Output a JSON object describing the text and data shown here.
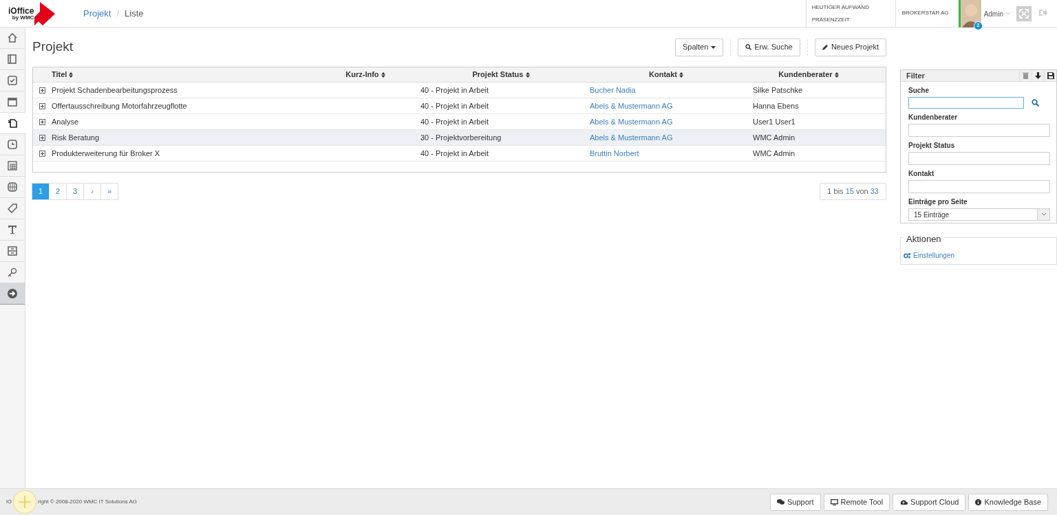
{
  "header": {
    "logo_text": "iOffice",
    "logo_sub": "by WMC",
    "breadcrumb": [
      "Projekt",
      "/",
      "Liste"
    ],
    "info": [
      "HEUTIGER AUFWAND",
      "PRÄSENZZEIT"
    ],
    "company": "BROKERSTAR AG",
    "user": "Admin",
    "notification_count": "2"
  },
  "sidebar": {
    "items": [
      {
        "kind": "home",
        "selected": false
      },
      {
        "kind": "notebook",
        "selected": false
      },
      {
        "kind": "check",
        "selected": false
      },
      {
        "kind": "calendar",
        "selected": false
      },
      {
        "kind": "project",
        "selected": true
      },
      {
        "kind": "clock",
        "selected": false
      },
      {
        "kind": "table",
        "selected": false
      },
      {
        "kind": "globe",
        "selected": false
      },
      {
        "kind": "tag",
        "selected": false
      },
      {
        "kind": "text",
        "selected": false
      },
      {
        "kind": "form",
        "selected": false
      },
      {
        "kind": "key",
        "selected": false
      },
      {
        "kind": "arrow",
        "selected": false
      }
    ]
  },
  "page": {
    "title": "Projekt",
    "buttons": [
      {
        "kind": "dropdown",
        "label": "Spalten"
      },
      {
        "kind": "search",
        "label": "Erw. Suche"
      },
      {
        "kind": "edit",
        "label": "Neues Projekt"
      }
    ]
  },
  "table": {
    "columns": [
      "Titel",
      "Kurz-Info",
      "Projekt Status",
      "Kontakt",
      "Kundenberater"
    ],
    "rows": [
      {
        "title": "Projekt Schadenbearbeitungsprozess",
        "status": "40 - Projekt in Arbeit",
        "contact": "Bucher Nadia",
        "advisor": "Silke Patschke",
        "selected": false
      },
      {
        "title": "Offertausschreibung Motorfahrzeugflotte",
        "status": "40 - Projekt in Arbeit",
        "contact": "Abels & Mustermann AG",
        "advisor": "Hanna Ebens",
        "selected": false
      },
      {
        "title": "Analyse",
        "status": "40 - Projekt in Arbeit",
        "contact": "Abels & Mustermann AG",
        "advisor": "User1 User1",
        "selected": false
      },
      {
        "title": "Risk Beratung",
        "status": "30 - Projektvorbereitung",
        "contact": "Abels & Mustermann AG",
        "advisor": "WMC Admin",
        "selected": true
      },
      {
        "title": "Produkterweiterung für Broker X",
        "status": "40 - Projekt in Arbeit",
        "contact": "Bruttin Norbert",
        "advisor": "WMC Admin",
        "selected": false
      }
    ]
  },
  "pagination": {
    "pages": [
      {
        "label": "1",
        "selected": true
      },
      {
        "label": "2",
        "selected": false
      },
      {
        "label": "3",
        "selected": false
      },
      {
        "label": "›",
        "selected": false
      },
      {
        "label": "»",
        "selected": false
      }
    ],
    "summary": [
      "1 bis ",
      "15",
      " von ",
      "33"
    ]
  },
  "filter": {
    "title": "Filter",
    "fields": [
      {
        "label": "Suche",
        "kind": "search",
        "focused": true
      },
      {
        "label": "Kundenberater",
        "kind": "text"
      },
      {
        "label": "Projekt Status",
        "kind": "text"
      },
      {
        "label": "Kontakt",
        "kind": "text"
      },
      {
        "label": "Einträge pro Seite",
        "kind": "select",
        "value": "15 Einträge"
      }
    ]
  },
  "actions": {
    "title": "Aktionen",
    "items": [
      "Einstellungen"
    ]
  },
  "footer": {
    "copyright_start": "iO",
    "copyright_end": "right © 2008-2020 WMC IT Solutions AG",
    "buttons": [
      {
        "kind": "chat",
        "label": "Support"
      },
      {
        "kind": "monitor",
        "label": "Remote Tool"
      },
      {
        "kind": "cloud",
        "label": "Support Cloud"
      },
      {
        "kind": "info",
        "label": "Knowledge Base"
      }
    ]
  }
}
